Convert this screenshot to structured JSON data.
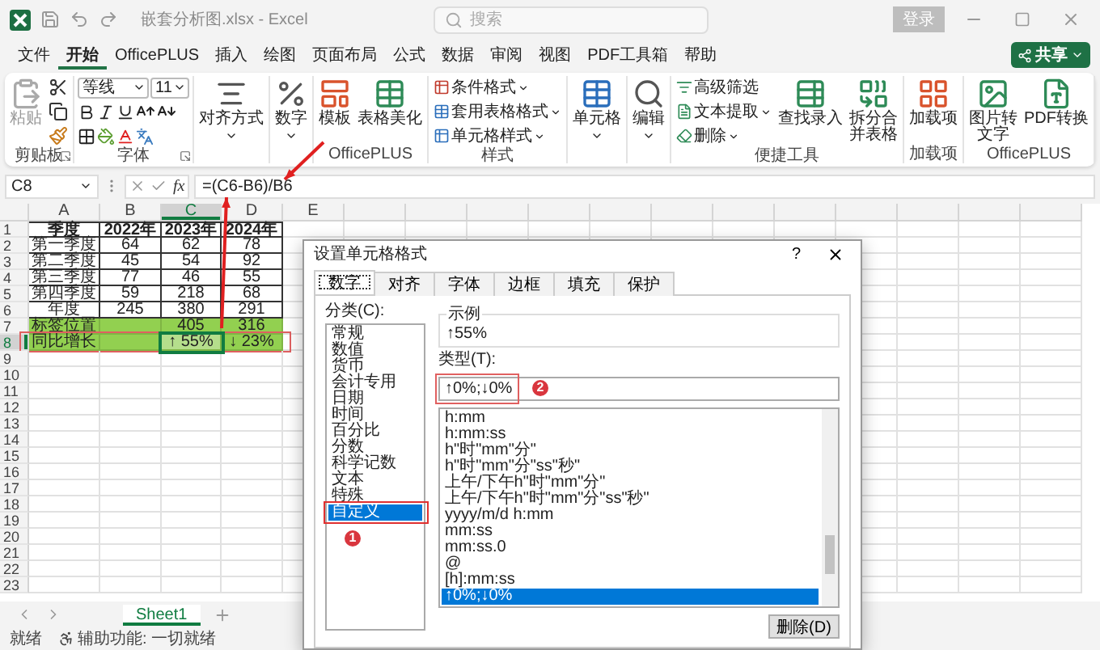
{
  "window": {
    "title": "嵌套分析图.xlsx - Excel",
    "search_placeholder": "搜索",
    "login": "登录"
  },
  "menu_tabs": [
    {
      "label": "文件",
      "selected": false
    },
    {
      "label": "开始",
      "selected": true
    },
    {
      "label": "OfficePLUS",
      "selected": false
    },
    {
      "label": "插入",
      "selected": false
    },
    {
      "label": "绘图",
      "selected": false
    },
    {
      "label": "页面布局",
      "selected": false
    },
    {
      "label": "公式",
      "selected": false
    },
    {
      "label": "数据",
      "selected": false
    },
    {
      "label": "审阅",
      "selected": false
    },
    {
      "label": "视图",
      "selected": false
    },
    {
      "label": "PDF工具箱",
      "selected": false
    },
    {
      "label": "帮助",
      "selected": false
    }
  ],
  "share_button": "共享",
  "ribbon": {
    "clipboard": {
      "label": "剪贴板",
      "paste": "粘贴"
    },
    "font": {
      "label": "字体",
      "font_name": "等线",
      "font_size": "11"
    },
    "alignment": {
      "label": "对齐方式"
    },
    "number": {
      "label": "数字"
    },
    "officeplus": {
      "label": "OfficePLUS",
      "items": [
        "模板",
        "表格美化"
      ]
    },
    "styles": {
      "label": "样式",
      "items": [
        "条件格式",
        "套用表格格式",
        "单元格样式"
      ]
    },
    "cells": {
      "label": "单元格"
    },
    "editing": {
      "label": "编辑"
    },
    "tools": {
      "label": "便捷工具",
      "small_items": [
        "高级筛选",
        "文本提取",
        "删除"
      ],
      "large_items": [
        "查找录入",
        "拆分合并表格"
      ]
    },
    "addins": {
      "label": "加载项",
      "button": "加载项"
    },
    "officeplus2": {
      "label": "OfficePLUS",
      "items": [
        "图片转文字",
        "PDF转换"
      ]
    }
  },
  "formula_bar": {
    "name_box": "C8",
    "function_label": "fx",
    "formula": "=(C6-B6)/B6"
  },
  "sheet": {
    "columns": [
      {
        "label": "A",
        "selected": false
      },
      {
        "label": "B",
        "selected": false
      },
      {
        "label": "C",
        "selected": true
      },
      {
        "label": "D",
        "selected": false
      },
      {
        "label": "E",
        "selected": false
      }
    ],
    "rows": [
      {
        "label": "1",
        "selected": false,
        "cells": [
          {
            "text": "季度",
            "kind": "head",
            "selected": false
          },
          {
            "text": "2022年",
            "kind": "head",
            "selected": false
          },
          {
            "text": "2023年",
            "kind": "head",
            "selected": false
          },
          {
            "text": "2024年",
            "kind": "head",
            "selected": false
          }
        ]
      },
      {
        "label": "2",
        "selected": false,
        "cells": [
          {
            "text": "第一季度",
            "kind": "data",
            "selected": false
          },
          {
            "text": "64",
            "kind": "data",
            "selected": false
          },
          {
            "text": "62",
            "kind": "data",
            "selected": false
          },
          {
            "text": "78",
            "kind": "data",
            "selected": false
          }
        ]
      },
      {
        "label": "3",
        "selected": false,
        "cells": [
          {
            "text": "第二季度",
            "kind": "data",
            "selected": false
          },
          {
            "text": "45",
            "kind": "data",
            "selected": false
          },
          {
            "text": "54",
            "kind": "data",
            "selected": false
          },
          {
            "text": "92",
            "kind": "data",
            "selected": false
          }
        ]
      },
      {
        "label": "4",
        "selected": false,
        "cells": [
          {
            "text": "第三季度",
            "kind": "data",
            "selected": false
          },
          {
            "text": "77",
            "kind": "data",
            "selected": false
          },
          {
            "text": "46",
            "kind": "data",
            "selected": false
          },
          {
            "text": "55",
            "kind": "data",
            "selected": false
          }
        ]
      },
      {
        "label": "5",
        "selected": false,
        "cells": [
          {
            "text": "第四季度",
            "kind": "data",
            "selected": false
          },
          {
            "text": "59",
            "kind": "data",
            "selected": false
          },
          {
            "text": "218",
            "kind": "data",
            "selected": false
          },
          {
            "text": "68",
            "kind": "data",
            "selected": false
          }
        ]
      },
      {
        "label": "6",
        "selected": false,
        "cells": [
          {
            "text": "年度",
            "kind": "data",
            "selected": false
          },
          {
            "text": "245",
            "kind": "data",
            "selected": false
          },
          {
            "text": "380",
            "kind": "data",
            "selected": false
          },
          {
            "text": "291",
            "kind": "data",
            "selected": false
          }
        ]
      },
      {
        "label": "7",
        "selected": false,
        "cells": [
          {
            "text": "标签位置",
            "kind": "green",
            "selected": false
          },
          {
            "kind": "green",
            "selected": false
          },
          {
            "text": "405",
            "kind": "green",
            "selected": false
          },
          {
            "text": "316",
            "kind": "green",
            "selected": false
          }
        ]
      },
      {
        "label": "8",
        "selected": true,
        "marked": true,
        "cells": [
          {
            "text": "同比增长",
            "kind": "green",
            "selected": false
          },
          {
            "kind": "green",
            "selected": false
          },
          {
            "text": "↑ 55%",
            "kind": "green",
            "selected": true
          },
          {
            "text": "↓ 23%",
            "kind": "green",
            "selected": false
          }
        ]
      },
      {
        "label": "9",
        "selected": false
      },
      {
        "label": "10",
        "selected": false
      },
      {
        "label": "11",
        "selected": false
      },
      {
        "label": "12",
        "selected": false
      },
      {
        "label": "13",
        "selected": false
      },
      {
        "label": "14",
        "selected": false
      },
      {
        "label": "15",
        "selected": false
      },
      {
        "label": "16",
        "selected": false
      },
      {
        "label": "17",
        "selected": false
      },
      {
        "label": "18",
        "selected": false
      },
      {
        "label": "19",
        "selected": false
      },
      {
        "label": "20",
        "selected": false
      },
      {
        "label": "21",
        "selected": false
      },
      {
        "label": "22",
        "selected": false
      },
      {
        "label": "23",
        "selected": false
      }
    ]
  },
  "sheet_tabs": [
    {
      "label": "Sheet1",
      "selected": true
    }
  ],
  "status_bar": {
    "ready": "就绪",
    "accessibility": "辅助功能: 一切就绪"
  },
  "dialog": {
    "title": "设置单元格格式",
    "help": "?",
    "tabs": [
      {
        "label": "数字",
        "selected": true
      },
      {
        "label": "对齐",
        "selected": false
      },
      {
        "label": "字体",
        "selected": false
      },
      {
        "label": "边框",
        "selected": false
      },
      {
        "label": "填充",
        "selected": false
      },
      {
        "label": "保护",
        "selected": false
      }
    ],
    "category_label": "分类(C):",
    "categories": [
      {
        "label": "常规",
        "selected": false
      },
      {
        "label": "数值",
        "selected": false
      },
      {
        "label": "货币",
        "selected": false
      },
      {
        "label": "会计专用",
        "selected": false
      },
      {
        "label": "日期",
        "selected": false
      },
      {
        "label": "时间",
        "selected": false
      },
      {
        "label": "百分比",
        "selected": false
      },
      {
        "label": "分数",
        "selected": false
      },
      {
        "label": "科学记数",
        "selected": false
      },
      {
        "label": "文本",
        "selected": false
      },
      {
        "label": "特殊",
        "selected": false
      },
      {
        "label": "自定义",
        "selected": true,
        "marked": true
      }
    ],
    "category_badge": "1",
    "sample_label": "示例",
    "sample_value": "↑55%",
    "type_label": "类型(T):",
    "type_value": "↑0%;↓0%",
    "type_marked": true,
    "type_badge": "2",
    "types": [
      {
        "label": "h:mm",
        "selected": false
      },
      {
        "label": "h:mm:ss",
        "selected": false
      },
      {
        "label": "h\"时\"mm\"分\"",
        "selected": false
      },
      {
        "label": "h\"时\"mm\"分\"ss\"秒\"",
        "selected": false
      },
      {
        "label": "上午/下午h\"时\"mm\"分\"",
        "selected": false
      },
      {
        "label": "上午/下午h\"时\"mm\"分\"ss\"秒\"",
        "selected": false
      },
      {
        "label": "yyyy/m/d h:mm",
        "selected": false
      },
      {
        "label": "mm:ss",
        "selected": false
      },
      {
        "label": "mm:ss.0",
        "selected": false
      },
      {
        "label": "@",
        "selected": false
      },
      {
        "label": "[h]:mm:ss",
        "selected": false
      },
      {
        "label": "↑0%;↓0%",
        "selected": true
      }
    ],
    "delete_button": "删除(D)"
  }
}
